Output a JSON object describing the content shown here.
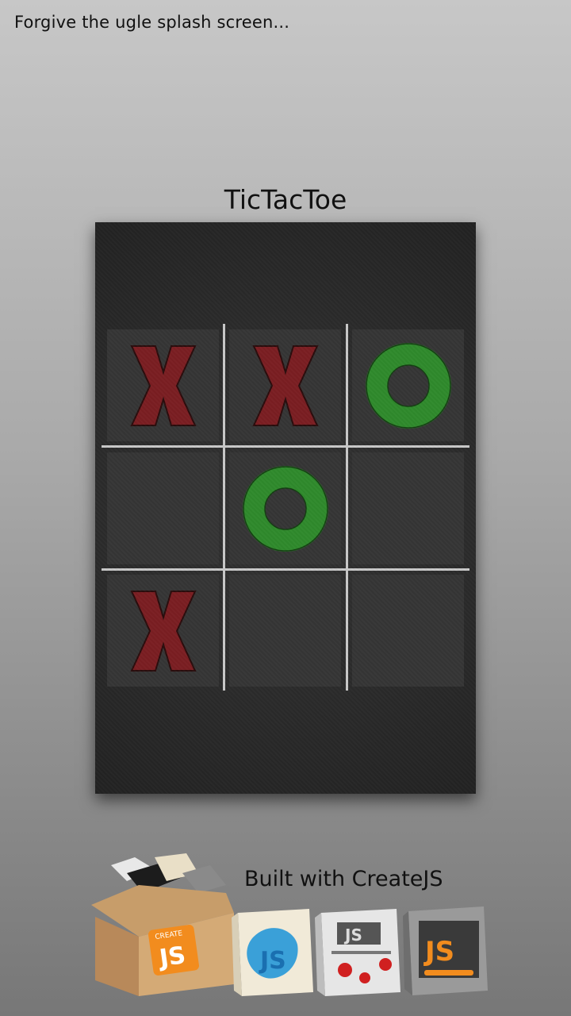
{
  "splash_note": "Forgive the ugle splash screen...",
  "title": "TicTacToe",
  "board": {
    "cells": [
      "X",
      "X",
      "O",
      "",
      "O",
      "",
      "X",
      "",
      ""
    ]
  },
  "footer": {
    "text": "Built with CreateJS"
  },
  "colors": {
    "x": "#7a1e22",
    "o": "#2f8a2c",
    "grid": "#c8c8c8",
    "board": "#2b2b2b"
  },
  "icons": [
    "createjs-box-icon",
    "easeljs-icon",
    "tweenjs-icon",
    "preloadjs-icon"
  ]
}
